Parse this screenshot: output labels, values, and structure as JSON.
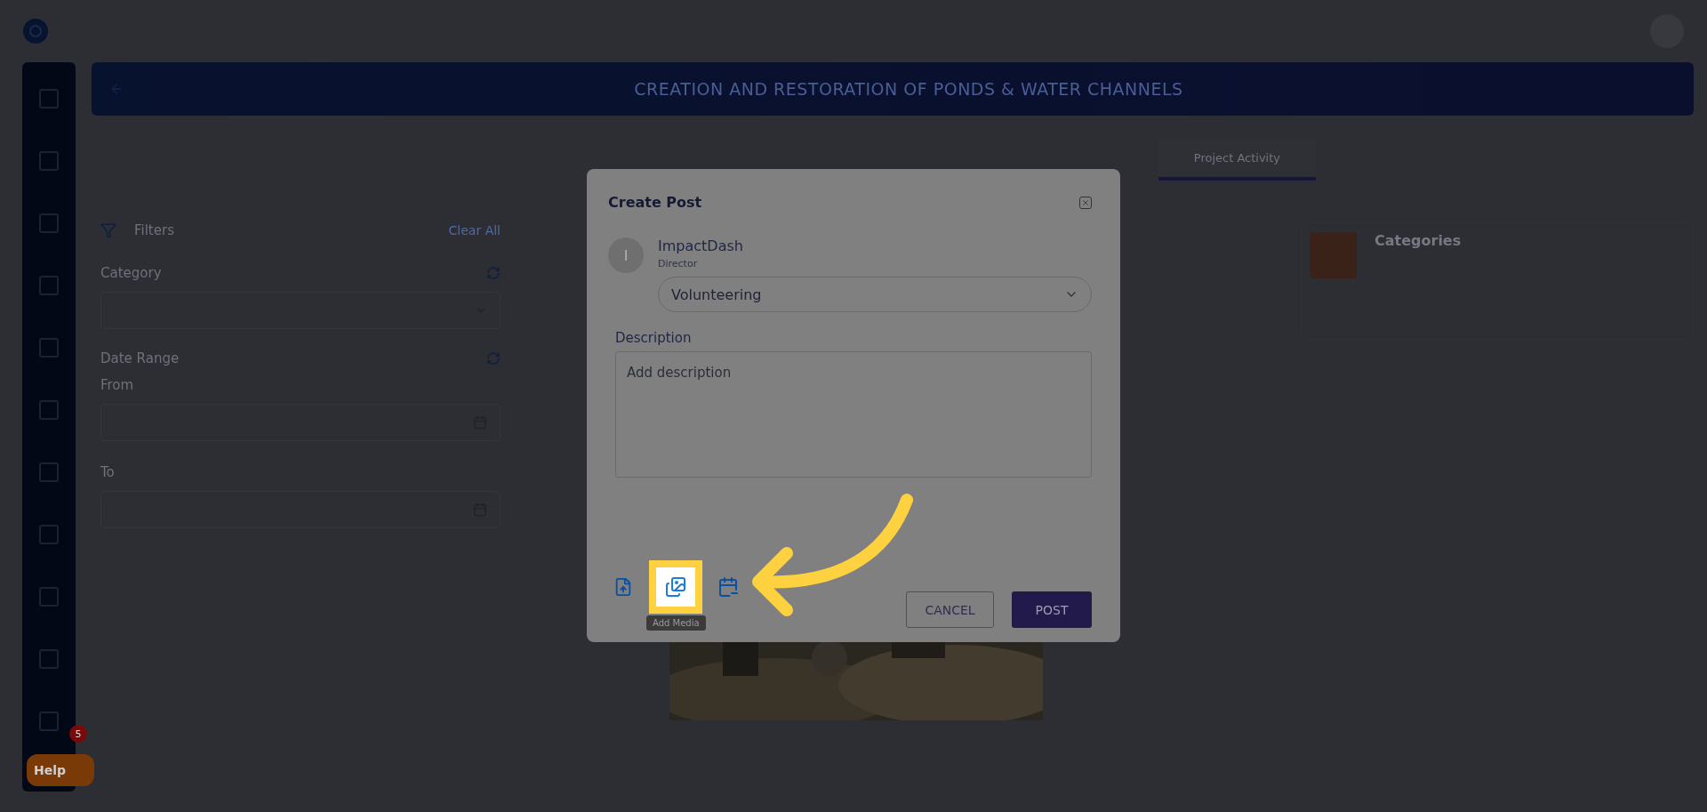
{
  "banner": {
    "title": "CREATION AND RESTORATION OF PONDS & WATER CHANNELS"
  },
  "tabs": [
    {
      "label": "Project Activity",
      "selected": true
    }
  ],
  "filters": {
    "title": "Filters",
    "clear": "Clear All",
    "category_label": "Category",
    "date_label": "Date Range",
    "from_label": "From",
    "to_label": "To"
  },
  "categories_card": {
    "title": "Categories"
  },
  "help": {
    "label": "Help",
    "badge": "5"
  },
  "modal": {
    "title": "Create Post",
    "avatar_initial": "I",
    "author": "ImpactDash",
    "role": "Director",
    "category": "Volunteering",
    "description_label": "Description",
    "description_placeholder": "Add description",
    "tools": [
      {
        "kind": "upload",
        "highlighted": false
      },
      {
        "kind": "media",
        "highlighted": true
      },
      {
        "kind": "calendar",
        "highlighted": false
      }
    ],
    "tooltip": "Add Media",
    "buttons": [
      {
        "kind": "secondary",
        "label": "CANCEL"
      },
      {
        "kind": "primary",
        "label": "POST"
      }
    ]
  }
}
